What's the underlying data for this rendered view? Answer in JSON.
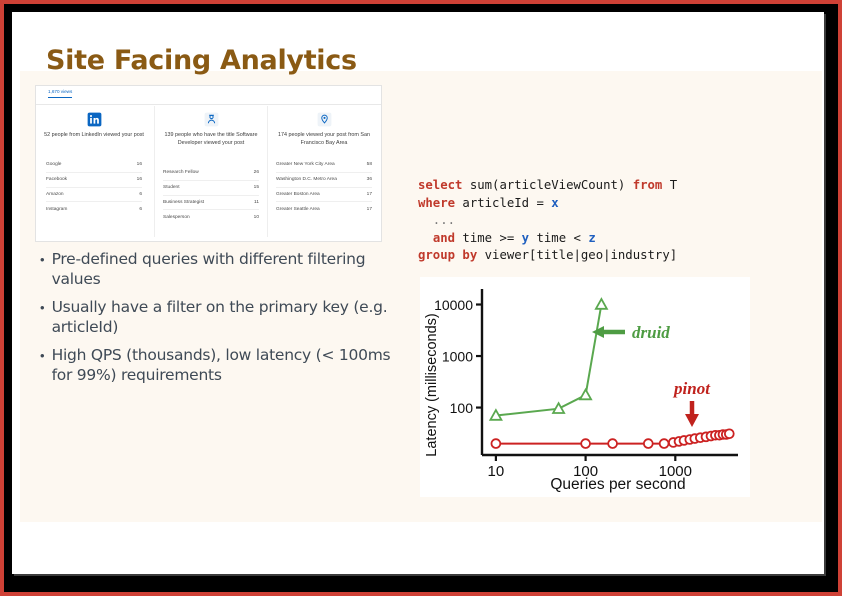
{
  "slide": {
    "title": "Site Facing Analytics",
    "title_color": "#8a5a14"
  },
  "linkedin_card": {
    "views_tab": "1,670 views",
    "columns": [
      {
        "icon": "linkedin-icon",
        "heading": "52 people from LinkedIn viewed your post",
        "rows": [
          {
            "label": "Google",
            "value": "16"
          },
          {
            "label": "Facebook",
            "value": "16"
          },
          {
            "label": "Amazon",
            "value": "6"
          },
          {
            "label": "Instagram",
            "value": "6"
          }
        ]
      },
      {
        "icon": "job-title-icon",
        "heading": "139 people who have the title Software Developer viewed your post",
        "rows": [
          {
            "label": "Research Fellow",
            "value": "26"
          },
          {
            "label": "Student",
            "value": "15"
          },
          {
            "label": "Business Strategist",
            "value": "11"
          },
          {
            "label": "Salesperson",
            "value": "10"
          }
        ]
      },
      {
        "icon": "location-pin-icon",
        "heading": "174 people viewed your post from San Francisco Bay Area",
        "rows": [
          {
            "label": "Greater New York City Area",
            "value": "58"
          },
          {
            "label": "Washington D.C. Metro Area",
            "value": "36"
          },
          {
            "label": "Greater Boston Area",
            "value": "17"
          },
          {
            "label": "Greater Seattle Area",
            "value": "17"
          }
        ]
      }
    ]
  },
  "bullets": [
    "Pre-defined queries with different filtering values",
    "Usually have a filter on the primary key (e.g. articleId)",
    "High QPS (thousands), low latency (< 100ms for 99%) requirements"
  ],
  "sql": {
    "lines": [
      [
        {
          "t": "select",
          "c": "kw"
        },
        {
          "t": " sum(articleViewCount) ",
          "c": ""
        },
        {
          "t": "from",
          "c": "kw"
        },
        {
          "t": " T",
          "c": ""
        }
      ],
      [
        {
          "t": "where",
          "c": "kw"
        },
        {
          "t": " articleId = ",
          "c": ""
        },
        {
          "t": "x",
          "c": "var"
        }
      ],
      [
        {
          "t": "  ...",
          "c": "dots"
        }
      ],
      [
        {
          "t": "  ",
          "c": ""
        },
        {
          "t": "and",
          "c": "kw"
        },
        {
          "t": " time >= ",
          "c": ""
        },
        {
          "t": "y",
          "c": "var"
        },
        {
          "t": " time < ",
          "c": ""
        },
        {
          "t": "z",
          "c": "var"
        }
      ],
      [
        {
          "t": "group by",
          "c": "kw"
        },
        {
          "t": " viewer[title|geo|industry]",
          "c": ""
        }
      ]
    ]
  },
  "chart_data": {
    "type": "line",
    "title": "",
    "xlabel": "Queries per second",
    "ylabel": "Latency (milliseconds)",
    "xscale": "log",
    "yscale": "log",
    "xlim": [
      7,
      5000
    ],
    "ylim": [
      12,
      20000
    ],
    "xticks": [
      10,
      100,
      1000
    ],
    "xticklabels": [
      "10",
      "100",
      "1000"
    ],
    "yticks": [
      100,
      1000,
      10000
    ],
    "yticklabels": [
      "100",
      "1000",
      "10000"
    ],
    "grid": false,
    "legend": "annotations",
    "series": [
      {
        "name": "druid",
        "color": "#5aa84f",
        "marker": "triangle",
        "annotation": "druid",
        "annotation_arrow": "left-arrow",
        "points": [
          {
            "x": 10,
            "y": 70
          },
          {
            "x": 50,
            "y": 95
          },
          {
            "x": 100,
            "y": 175
          },
          {
            "x": 150,
            "y": 10000
          }
        ]
      },
      {
        "name": "pinot",
        "color": "#cc2222",
        "marker": "circle",
        "annotation": "pinot",
        "annotation_arrow": "down-arrow",
        "points": [
          {
            "x": 10,
            "y": 20
          },
          {
            "x": 100,
            "y": 20
          },
          {
            "x": 200,
            "y": 20
          },
          {
            "x": 500,
            "y": 20
          },
          {
            "x": 750,
            "y": 20
          },
          {
            "x": 950,
            "y": 21
          },
          {
            "x": 1100,
            "y": 22
          },
          {
            "x": 1250,
            "y": 23
          },
          {
            "x": 1450,
            "y": 24
          },
          {
            "x": 1650,
            "y": 25
          },
          {
            "x": 1900,
            "y": 26
          },
          {
            "x": 2200,
            "y": 27
          },
          {
            "x": 2500,
            "y": 28
          },
          {
            "x": 2800,
            "y": 29
          },
          {
            "x": 3100,
            "y": 29
          },
          {
            "x": 3400,
            "y": 30
          },
          {
            "x": 3700,
            "y": 30
          },
          {
            "x": 4000,
            "y": 31
          }
        ]
      }
    ]
  }
}
